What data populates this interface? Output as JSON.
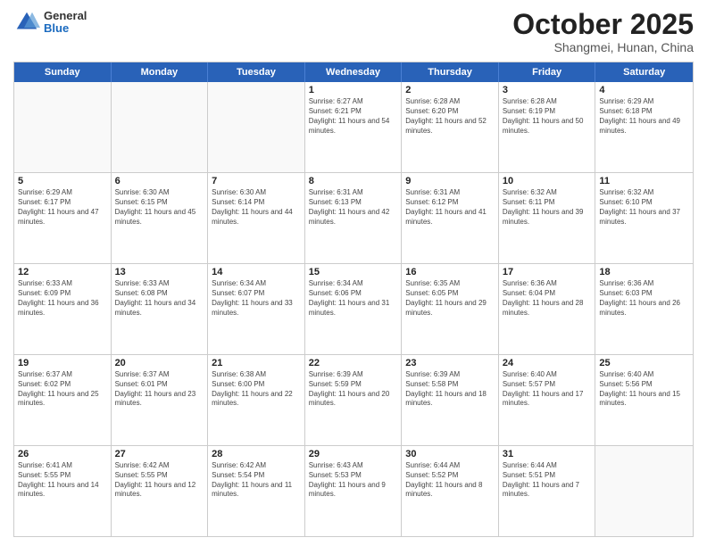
{
  "header": {
    "logo": {
      "general": "General",
      "blue": "Blue"
    },
    "title": "October 2025",
    "subtitle": "Shangmei, Hunan, China"
  },
  "days_of_week": [
    "Sunday",
    "Monday",
    "Tuesday",
    "Wednesday",
    "Thursday",
    "Friday",
    "Saturday"
  ],
  "weeks": [
    [
      {
        "day": "",
        "empty": true
      },
      {
        "day": "",
        "empty": true
      },
      {
        "day": "",
        "empty": true
      },
      {
        "day": "1",
        "sunrise": "6:27 AM",
        "sunset": "6:21 PM",
        "daylight": "11 hours and 54 minutes."
      },
      {
        "day": "2",
        "sunrise": "6:28 AM",
        "sunset": "6:20 PM",
        "daylight": "11 hours and 52 minutes."
      },
      {
        "day": "3",
        "sunrise": "6:28 AM",
        "sunset": "6:19 PM",
        "daylight": "11 hours and 50 minutes."
      },
      {
        "day": "4",
        "sunrise": "6:29 AM",
        "sunset": "6:18 PM",
        "daylight": "11 hours and 49 minutes."
      }
    ],
    [
      {
        "day": "5",
        "sunrise": "6:29 AM",
        "sunset": "6:17 PM",
        "daylight": "11 hours and 47 minutes."
      },
      {
        "day": "6",
        "sunrise": "6:30 AM",
        "sunset": "6:15 PM",
        "daylight": "11 hours and 45 minutes."
      },
      {
        "day": "7",
        "sunrise": "6:30 AM",
        "sunset": "6:14 PM",
        "daylight": "11 hours and 44 minutes."
      },
      {
        "day": "8",
        "sunrise": "6:31 AM",
        "sunset": "6:13 PM",
        "daylight": "11 hours and 42 minutes."
      },
      {
        "day": "9",
        "sunrise": "6:31 AM",
        "sunset": "6:12 PM",
        "daylight": "11 hours and 41 minutes."
      },
      {
        "day": "10",
        "sunrise": "6:32 AM",
        "sunset": "6:11 PM",
        "daylight": "11 hours and 39 minutes."
      },
      {
        "day": "11",
        "sunrise": "6:32 AM",
        "sunset": "6:10 PM",
        "daylight": "11 hours and 37 minutes."
      }
    ],
    [
      {
        "day": "12",
        "sunrise": "6:33 AM",
        "sunset": "6:09 PM",
        "daylight": "11 hours and 36 minutes."
      },
      {
        "day": "13",
        "sunrise": "6:33 AM",
        "sunset": "6:08 PM",
        "daylight": "11 hours and 34 minutes."
      },
      {
        "day": "14",
        "sunrise": "6:34 AM",
        "sunset": "6:07 PM",
        "daylight": "11 hours and 33 minutes."
      },
      {
        "day": "15",
        "sunrise": "6:34 AM",
        "sunset": "6:06 PM",
        "daylight": "11 hours and 31 minutes."
      },
      {
        "day": "16",
        "sunrise": "6:35 AM",
        "sunset": "6:05 PM",
        "daylight": "11 hours and 29 minutes."
      },
      {
        "day": "17",
        "sunrise": "6:36 AM",
        "sunset": "6:04 PM",
        "daylight": "11 hours and 28 minutes."
      },
      {
        "day": "18",
        "sunrise": "6:36 AM",
        "sunset": "6:03 PM",
        "daylight": "11 hours and 26 minutes."
      }
    ],
    [
      {
        "day": "19",
        "sunrise": "6:37 AM",
        "sunset": "6:02 PM",
        "daylight": "11 hours and 25 minutes."
      },
      {
        "day": "20",
        "sunrise": "6:37 AM",
        "sunset": "6:01 PM",
        "daylight": "11 hours and 23 minutes."
      },
      {
        "day": "21",
        "sunrise": "6:38 AM",
        "sunset": "6:00 PM",
        "daylight": "11 hours and 22 minutes."
      },
      {
        "day": "22",
        "sunrise": "6:39 AM",
        "sunset": "5:59 PM",
        "daylight": "11 hours and 20 minutes."
      },
      {
        "day": "23",
        "sunrise": "6:39 AM",
        "sunset": "5:58 PM",
        "daylight": "11 hours and 18 minutes."
      },
      {
        "day": "24",
        "sunrise": "6:40 AM",
        "sunset": "5:57 PM",
        "daylight": "11 hours and 17 minutes."
      },
      {
        "day": "25",
        "sunrise": "6:40 AM",
        "sunset": "5:56 PM",
        "daylight": "11 hours and 15 minutes."
      }
    ],
    [
      {
        "day": "26",
        "sunrise": "6:41 AM",
        "sunset": "5:55 PM",
        "daylight": "11 hours and 14 minutes."
      },
      {
        "day": "27",
        "sunrise": "6:42 AM",
        "sunset": "5:55 PM",
        "daylight": "11 hours and 12 minutes."
      },
      {
        "day": "28",
        "sunrise": "6:42 AM",
        "sunset": "5:54 PM",
        "daylight": "11 hours and 11 minutes."
      },
      {
        "day": "29",
        "sunrise": "6:43 AM",
        "sunset": "5:53 PM",
        "daylight": "11 hours and 9 minutes."
      },
      {
        "day": "30",
        "sunrise": "6:44 AM",
        "sunset": "5:52 PM",
        "daylight": "11 hours and 8 minutes."
      },
      {
        "day": "31",
        "sunrise": "6:44 AM",
        "sunset": "5:51 PM",
        "daylight": "11 hours and 7 minutes."
      },
      {
        "day": "",
        "empty": true
      }
    ]
  ]
}
